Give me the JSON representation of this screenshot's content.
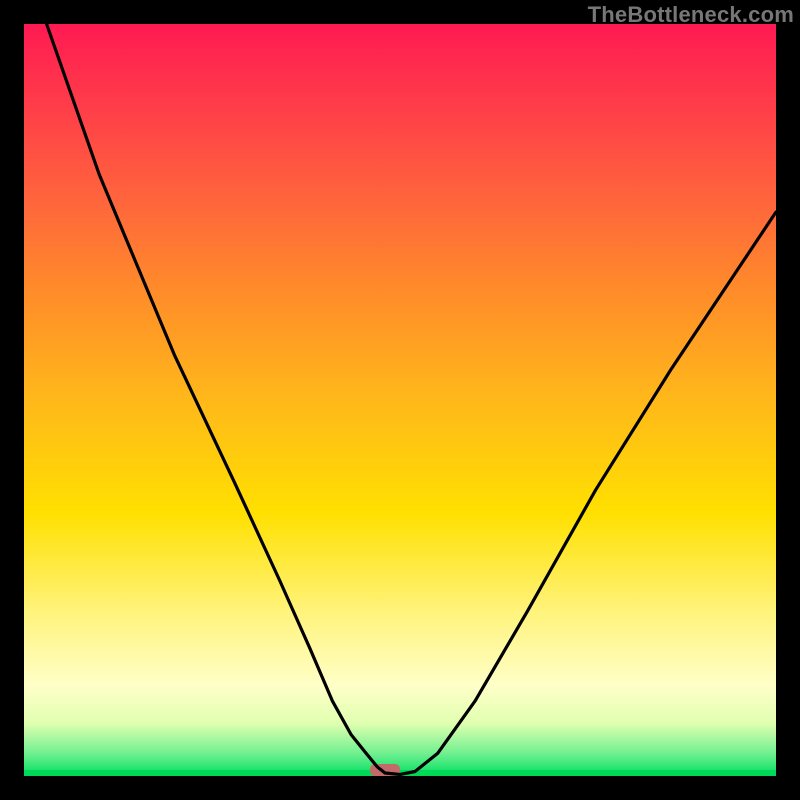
{
  "watermark": "TheBottleneck.com",
  "chart_data": {
    "type": "line",
    "title": "",
    "xlabel": "",
    "ylabel": "",
    "xlim": [
      0,
      100
    ],
    "ylim": [
      0,
      100
    ],
    "series": [
      {
        "name": "curve",
        "x": [
          3,
          10,
          20,
          28,
          34,
          38,
          41,
          43.5,
          45.5,
          47,
          48,
          50,
          52,
          55,
          60,
          67,
          76,
          86,
          100
        ],
        "values": [
          100,
          80,
          56,
          39,
          26,
          17,
          10,
          5.5,
          3,
          1.2,
          0.4,
          0.2,
          0.6,
          3,
          10,
          22,
          38,
          54,
          75
        ]
      }
    ],
    "marker": {
      "x": 48,
      "width": 4,
      "color": "#c56a6a"
    },
    "green_band_y": 0.4
  }
}
